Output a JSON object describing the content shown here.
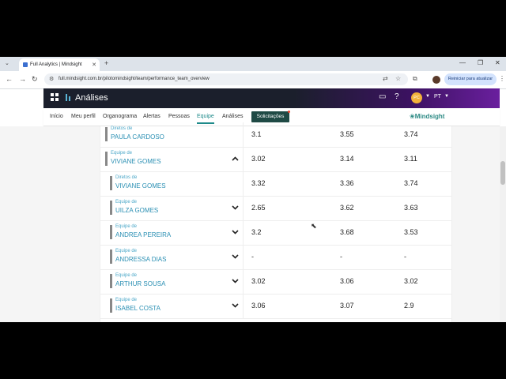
{
  "browser": {
    "tab_title": "Full Analytics | Mindsight",
    "url": "full.mindsight.com.br/pilotomindsight/team/performance_team_overview",
    "update_button": "Reiniciar para atualizar"
  },
  "app": {
    "name": "Análises",
    "avatar_initials": "PC",
    "language": "PT",
    "logo": "Mindsight"
  },
  "nav": {
    "items": [
      "Início",
      "Meu perfil",
      "Organograma",
      "Alertas",
      "Pessoas",
      "Equipe",
      "Análises"
    ],
    "active": "Equipe",
    "button": "Solicitações"
  },
  "rows": [
    {
      "type": "Diretos de",
      "name": "PAULA CARDOSO",
      "values": [
        "3.1",
        "3.55",
        "3.74"
      ],
      "chevron": ""
    },
    {
      "type": "Equipe de",
      "name": "VIVIANE GOMES",
      "values": [
        "3.02",
        "3.14",
        "3.11"
      ],
      "chevron": "up"
    },
    {
      "type": "Diretos de",
      "name": "VIVIANE GOMES",
      "values": [
        "3.32",
        "3.36",
        "3.74"
      ],
      "chevron": ""
    },
    {
      "type": "Equipe de",
      "name": "UILZA GOMES",
      "values": [
        "2.65",
        "3.62",
        "3.63"
      ],
      "chevron": "down"
    },
    {
      "type": "Equipe de",
      "name": "ANDREA PEREIRA",
      "values": [
        "3.2",
        "3.68",
        "3.53"
      ],
      "chevron": "down"
    },
    {
      "type": "Equipe de",
      "name": "ANDRESSA DIAS",
      "values": [
        "-",
        "-",
        "-"
      ],
      "chevron": "down"
    },
    {
      "type": "Equipe de",
      "name": "ARTHUR SOUSA",
      "values": [
        "3.02",
        "3.06",
        "3.02"
      ],
      "chevron": "down"
    },
    {
      "type": "Equipe de",
      "name": "ISABEL COSTA",
      "values": [
        "3.06",
        "3.07",
        "2.9"
      ],
      "chevron": "down"
    }
  ]
}
